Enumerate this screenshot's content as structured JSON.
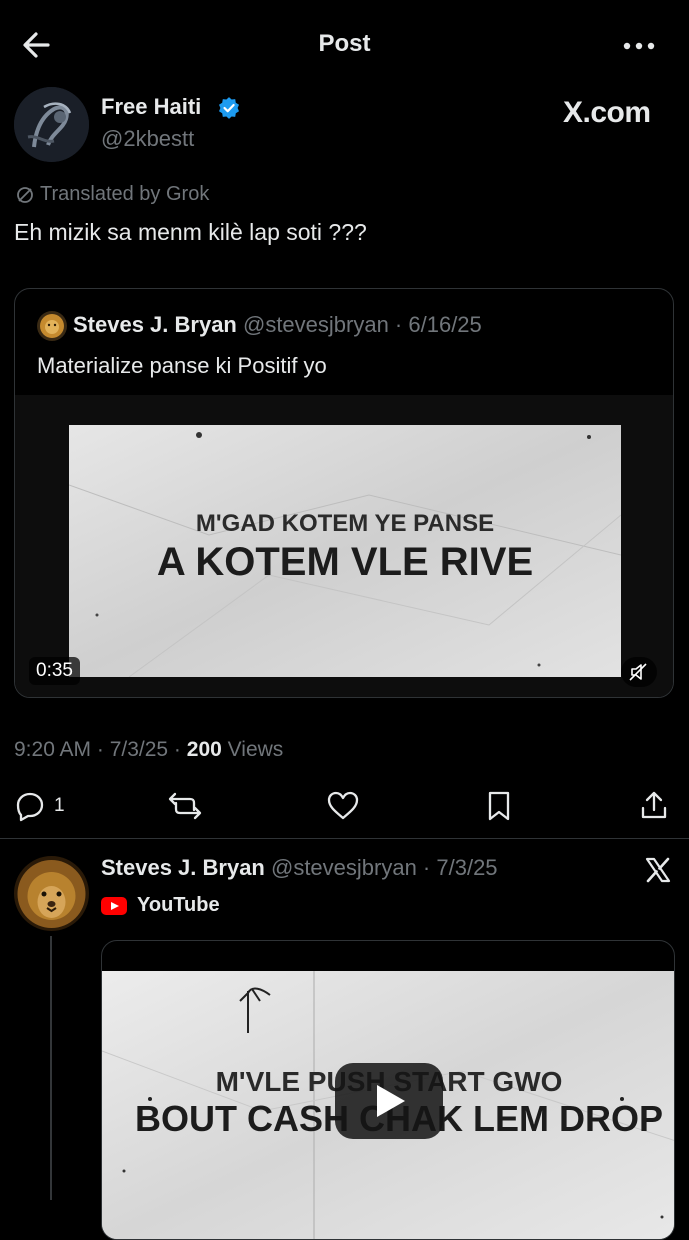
{
  "header": {
    "title": "Post"
  },
  "post": {
    "author_name": "Free Haiti",
    "author_handle": "@2kbestt",
    "brand": "X.com",
    "translated_label": "Translated by Grok",
    "text": "Eh mizik sa menm kilè lap soti ???",
    "timestamp": "9:20 AM · 7/3/25 · ",
    "views_count": "200",
    "views_label": " Views"
  },
  "quote": {
    "author_name": "Steves J. Bryan",
    "author_meta": " @stevesjbryan · 6/16/25",
    "text": "Materialize panse ki Positif yo",
    "video_line1": "M'GAD KOTEM YE PANSE",
    "video_line2": "A KOTEM VLE RIVE",
    "duration": "0:35"
  },
  "actions": {
    "reply_count": "1"
  },
  "reply": {
    "author_name": "Steves J. Bryan",
    "author_meta": " @stevesjbryan · 7/3/25",
    "source": "YouTube",
    "video_line1": "M'VLE PUSH START GWO",
    "video_line2": "BOUT CASH CHAK LEM DROP"
  },
  "colors": {
    "accent": "#1d9bf0",
    "muted": "#71767b",
    "youtube": "#ff0000"
  },
  "icons": [
    "back-arrow-icon",
    "more-icon",
    "verified-badge-icon",
    "grok-translate-icon",
    "mute-icon",
    "reply-icon",
    "repost-icon",
    "like-icon",
    "bookmark-icon",
    "share-icon",
    "x-logo-icon",
    "youtube-icon",
    "play-icon"
  ]
}
